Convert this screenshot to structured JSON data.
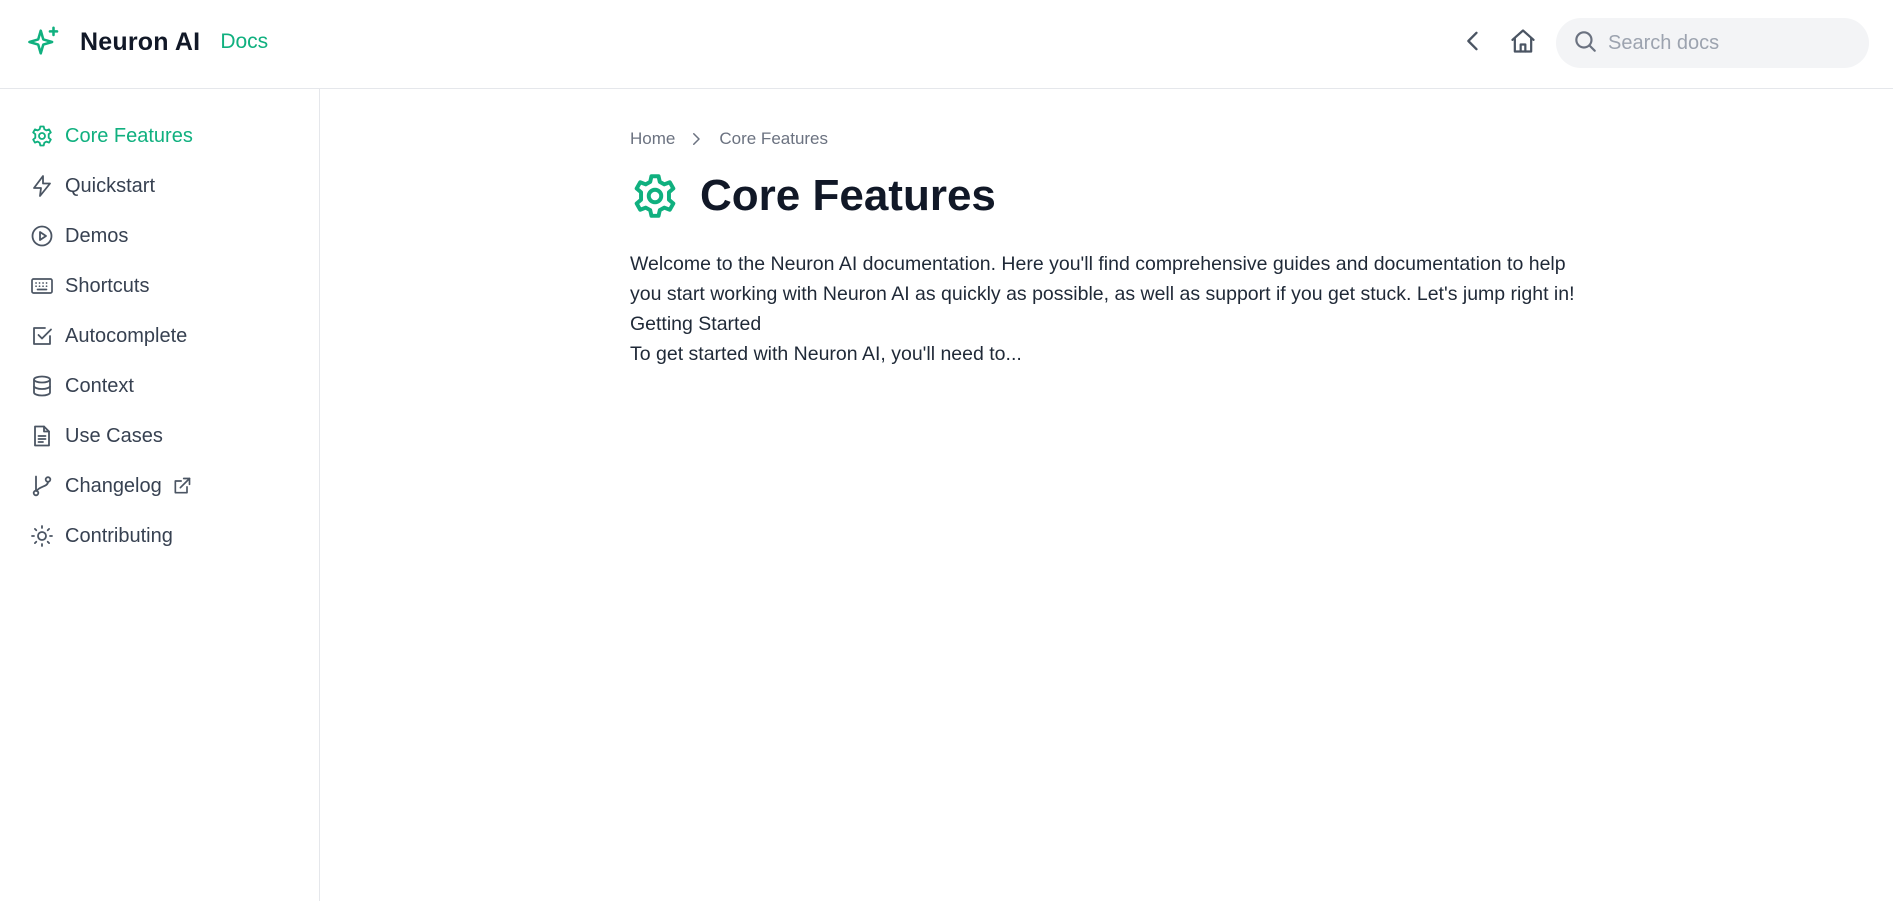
{
  "header": {
    "brand_name": "Neuron AI",
    "brand_docs": "Docs",
    "brand_icon": "sparkles-icon",
    "search_placeholder": "Search docs"
  },
  "colors": {
    "accent": "#10b07f",
    "text": "#111827",
    "muted": "#6b7280",
    "border": "#e5e7eb",
    "search_bg": "#f3f4f6"
  },
  "sidebar": {
    "items": [
      {
        "label": "Core Features",
        "icon": "gear-icon",
        "active": true
      },
      {
        "label": "Quickstart",
        "icon": "lightning-icon",
        "active": false
      },
      {
        "label": "Demos",
        "icon": "play-circle-icon",
        "active": false
      },
      {
        "label": "Shortcuts",
        "icon": "keyboard-icon",
        "active": false
      },
      {
        "label": "Autocomplete",
        "icon": "check-square-icon",
        "active": false
      },
      {
        "label": "Context",
        "icon": "database-icon",
        "active": false
      },
      {
        "label": "Use Cases",
        "icon": "document-icon",
        "active": false
      },
      {
        "label": "Changelog",
        "icon": "git-branch-icon",
        "active": false,
        "external": true
      },
      {
        "label": "Contributing",
        "icon": "sun-icon",
        "active": false
      }
    ]
  },
  "main": {
    "breadcrumb": [
      "Home",
      "Core Features"
    ],
    "title": "Core Features",
    "title_icon": "gear-icon",
    "intro": "Welcome to the Neuron AI documentation. Here you'll find comprehensive guides and documentation to help you start working with Neuron AI as quickly as possible, as well as support if you get stuck. Let's jump right in!",
    "section_heading": "Getting Started",
    "section_text": "To get started with Neuron AI, you'll need to..."
  }
}
